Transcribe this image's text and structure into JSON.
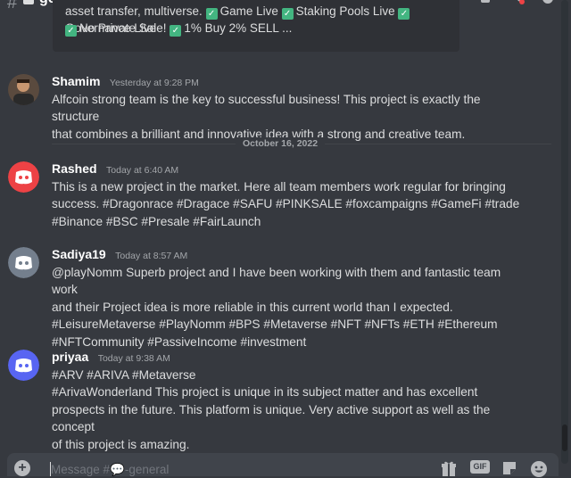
{
  "channel": {
    "name": "general"
  },
  "embed": {
    "line1_prefix": "asset transfer, multiverse.",
    "item_game": "Game Live",
    "item_staking": "Staking Pools Live",
    "item_governance": "Governance Live",
    "item_presale": "No Private Sale!",
    "item_tax": "1% Buy 2% SELL ..."
  },
  "messages": [
    {
      "author": "Shamim",
      "time": "Yesterday at 9:28 PM",
      "lines": [
        "Alfcoin strong team is the key to successful business! This project is exactly the structure",
        "that combines a brilliant and innovative idea with a strong and creative team."
      ],
      "avatar": "photo-avatar"
    },
    {
      "author": "Rashed",
      "time": "Today at 6:40 AM",
      "lines": [
        "This is a new project in the market. Here all team members work regular for bringing",
        "success. #Dragonrace #Dragace #SAFU #PINKSALE #foxcampaigns #GameFi #trade",
        "#Binance #BSC #Presale #FairLaunch"
      ],
      "avatar_color": "#ed4245"
    },
    {
      "author": "Sadiya19",
      "time": "Today at 8:57 AM",
      "lines": [
        "@playNomm Superb project and I have been working with them and fantastic team work",
        "and their Project idea is more reliable in this current world than I expected.",
        "#LeisureMetaverse #PlayNomm #BPS #Metaverse #NFT #NFTs #ETH #Ethereum",
        "#NFTCommunity #PassiveIncome #investment"
      ],
      "avatar_color": "#747f8d"
    },
    {
      "author": "priyaa",
      "time": "Today at 9:38 AM",
      "lines": [
        "#ARV #ARIVA #Metaverse",
        "#ArivaWonderland  This project is unique in its subject matter and has excellent",
        "prospects in the future. This platform is unique. Very active support as well as the concept",
        "of this project is amazing."
      ],
      "avatar_color": "#5865f2"
    }
  ],
  "date_divider": "October 16, 2022",
  "composer": {
    "placeholder": "Message #💬-general",
    "gif_label": "GIF"
  },
  "icons": {
    "discord_avatar": "discord-logo-icon",
    "plus": "plus-circle-icon",
    "gift": "gift-icon",
    "gif": "gif-icon",
    "sticker": "sticker-icon",
    "emoji": "emoji-icon"
  }
}
